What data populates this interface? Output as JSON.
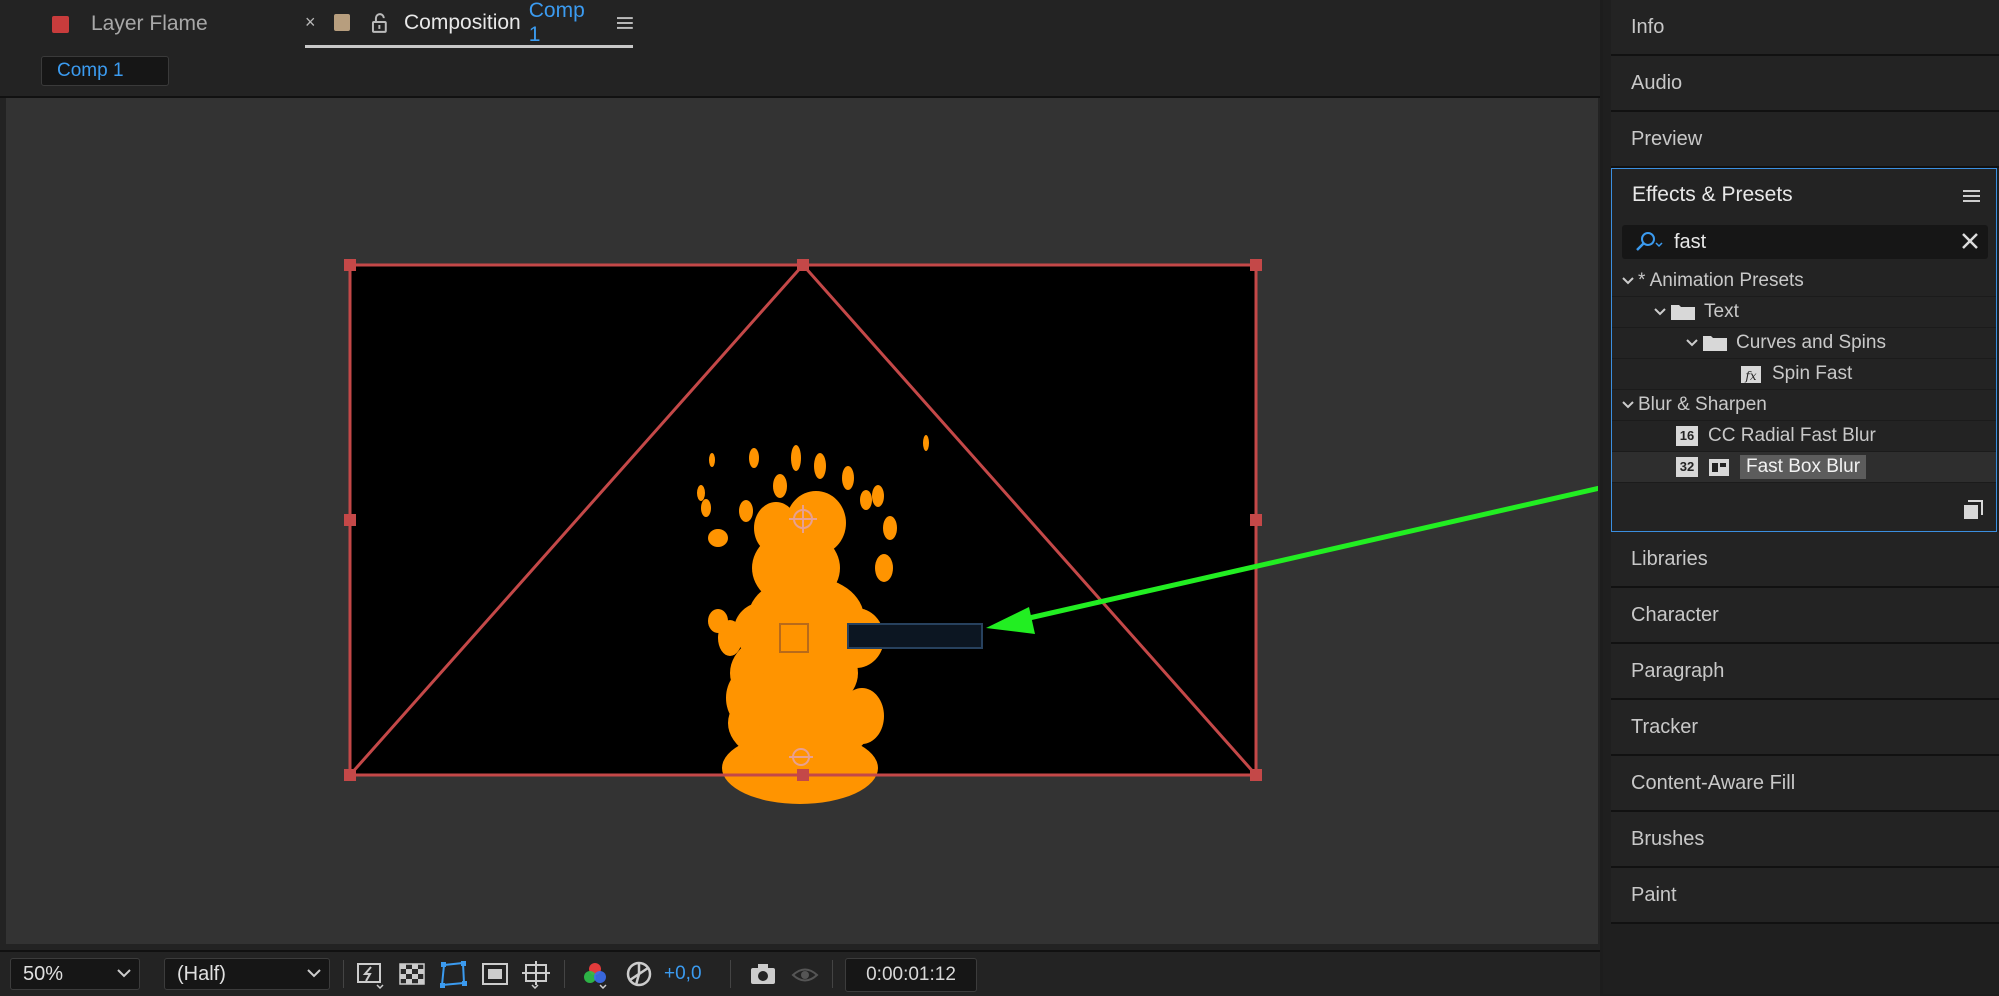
{
  "tabs": {
    "layer_tab": "Layer Flame",
    "comp_tab_prefix": "Composition",
    "comp_tab_name": "Comp 1",
    "close_glyph": "×"
  },
  "sub_tab": "Comp 1",
  "viewer": {
    "layer_bounds_color": "#c44848",
    "flame_color": "#ff9400",
    "arrow_color": "#22ee22",
    "background": "#333333",
    "comp_background": "#000000"
  },
  "toolbar": {
    "zoom": "50%",
    "resolution": "(Half)",
    "exposure": "+0,0",
    "timecode": "0:00:01:12"
  },
  "right_panels": {
    "top": [
      "Info",
      "Audio",
      "Preview"
    ],
    "bottom": [
      "Libraries",
      "Character",
      "Paragraph",
      "Tracker",
      "Content-Aware Fill",
      "Brushes",
      "Paint"
    ]
  },
  "effects": {
    "title": "Effects & Presets",
    "search_value": "fast",
    "tree": [
      {
        "label": "* Animation Presets"
      },
      {
        "label": "Text"
      },
      {
        "label": "Curves and Spins"
      },
      {
        "label": "Spin Fast"
      },
      {
        "label": "Blur & Sharpen"
      },
      {
        "label": "CC Radial Fast Blur"
      },
      {
        "label": "Fast Box Blur"
      }
    ],
    "badges": {
      "bit16": "16",
      "bit32": "32"
    }
  }
}
